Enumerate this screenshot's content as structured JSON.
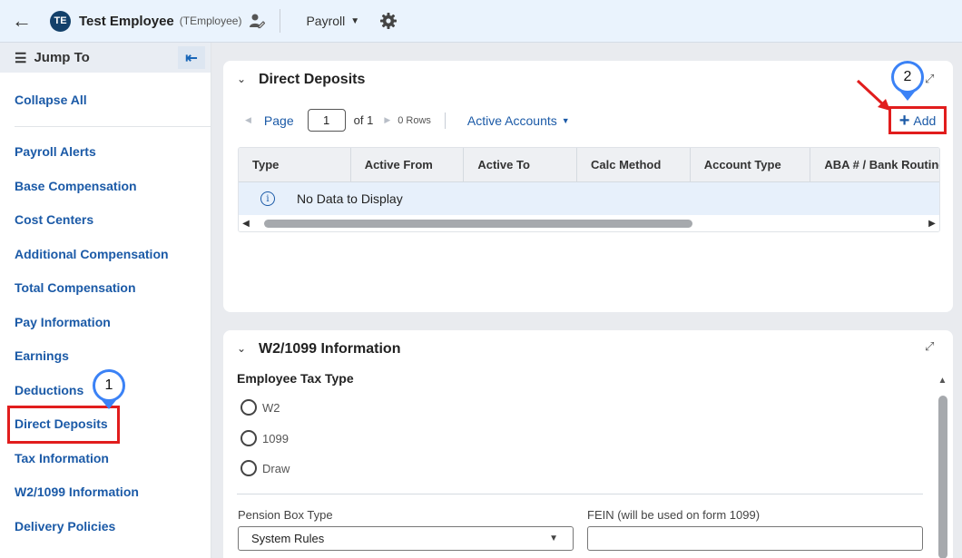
{
  "header": {
    "back_icon": "arrow-left-icon",
    "avatar_initials": "TE",
    "employee_name": "Test Employee",
    "employee_username": "(TEmployee)",
    "menu_label": "Payroll"
  },
  "sidebar": {
    "jump_to": "Jump To",
    "collapse_all": "Collapse All",
    "items": [
      {
        "label": "Payroll Alerts"
      },
      {
        "label": "Base Compensation"
      },
      {
        "label": "Cost Centers"
      },
      {
        "label": "Additional Compensation"
      },
      {
        "label": "Total Compensation"
      },
      {
        "label": "Pay Information"
      },
      {
        "label": "Earnings"
      },
      {
        "label": "Deductions"
      },
      {
        "label": "Direct Deposits"
      },
      {
        "label": "Tax Information"
      },
      {
        "label": "W2/1099 Information"
      },
      {
        "label": "Delivery Policies"
      }
    ]
  },
  "direct_deposits": {
    "title": "Direct Deposits",
    "page_label": "Page",
    "page_value": "1",
    "of_label": "of 1",
    "rows_label": "0 Rows",
    "filter_label": "Active Accounts",
    "add_label": "Add",
    "columns": [
      "Type",
      "Active From",
      "Active To",
      "Calc Method",
      "Account Type",
      "ABA # / Bank Routing"
    ],
    "empty_message": "No Data to Display"
  },
  "w2": {
    "title": "W2/1099 Information",
    "tax_type_label": "Employee Tax Type",
    "options": [
      "W2",
      "1099",
      "Draw"
    ],
    "pension_label": "Pension Box Type",
    "pension_value": "System Rules",
    "fein_label": "FEIN (will be used on form 1099)"
  },
  "callouts": {
    "step1": "1",
    "step2": "2"
  },
  "colors": {
    "accent": "#1b5aa7",
    "highlight": "#e11d1d",
    "callout": "#3b82f6"
  }
}
